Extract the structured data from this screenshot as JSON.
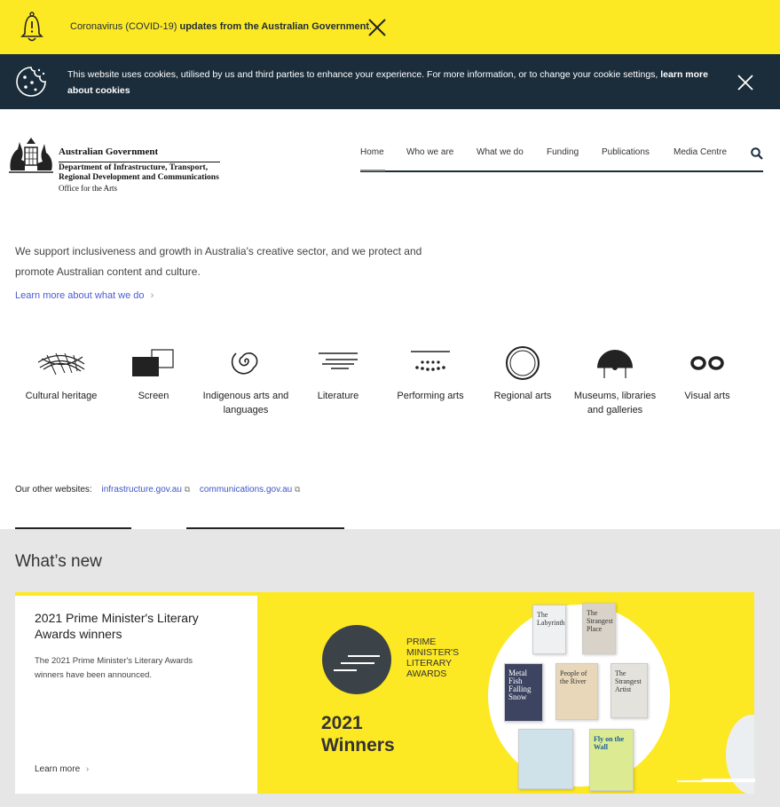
{
  "covid": {
    "prefix": "Coronavirus (COVID-19) ",
    "bold": "updates from the Australian Government",
    "suffix": "."
  },
  "cookie": {
    "text": "This website uses cookies, utilised by us and third parties to enhance your experience. For more information, or to change your cookie settings, ",
    "link": "learn more about cookies"
  },
  "logo": {
    "line1": "Australian Government",
    "line2a": "Department of Infrastructure, Transport,",
    "line2b": "Regional Development and Communications",
    "line3": "Office for the Arts"
  },
  "nav": {
    "items": [
      "Home",
      "Who we are",
      "What we do",
      "Funding",
      "Publications",
      "Media Centre"
    ]
  },
  "intro": {
    "text": "We support inclusiveness and growth in Australia's creative sector, and we protect and promote Australian content and culture.",
    "link": "Learn more about what we do"
  },
  "categories": [
    {
      "label": "Cultural heritage",
      "icon": "net-icon"
    },
    {
      "label": "Screen",
      "icon": "screen-icon"
    },
    {
      "label": "Indigenous arts and languages",
      "icon": "spiral-icon"
    },
    {
      "label": "Literature",
      "icon": "lines-icon"
    },
    {
      "label": "Performing arts",
      "icon": "audience-icon"
    },
    {
      "label": "Regional arts",
      "icon": "ring-icon"
    },
    {
      "label": "Museums, libraries and galleries",
      "icon": "dome-icon"
    },
    {
      "label": "Visual arts",
      "icon": "glasses-icon"
    }
  ],
  "other_sites": {
    "label": "Our other websites:",
    "links": [
      "infrastructure.gov.au",
      "communications.gov.au"
    ]
  },
  "whats_new": {
    "heading": "What’s new",
    "card": {
      "title": "2021 Prime Minister's Literary Awards winners",
      "desc": "The 2021 Prime Minister's Literary Awards winners have been announced.",
      "link": "Learn more"
    },
    "banner": {
      "award_l1": "PRIME",
      "award_l2": "MINISTER'S",
      "award_l3": "LITERARY",
      "award_l4": "AWARDS",
      "year": "2021",
      "winners": "Winners",
      "books": [
        "The Labyrinth",
        "The Strangest Place",
        "Metal Fish Falling Snow",
        "People of the River",
        "The Strangest Artist",
        "Fly on the Wall"
      ]
    }
  },
  "colors": {
    "yellow": "#fde824",
    "navy": "#1b2d3b",
    "link": "#4b5bd6"
  }
}
